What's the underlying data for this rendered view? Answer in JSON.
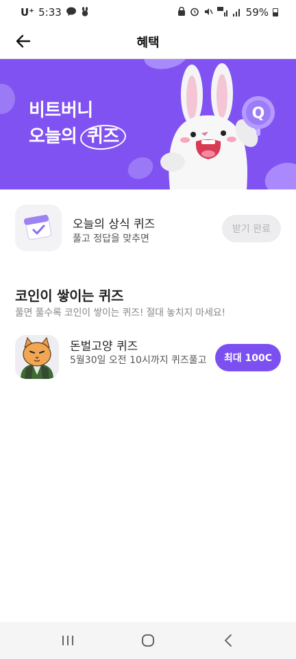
{
  "status_bar": {
    "carrier": "U⁺",
    "time": "5:33",
    "battery": "59%"
  },
  "header": {
    "title": "혜택",
    "back_icon": "arrow-left-icon"
  },
  "banner": {
    "line1": "비트버니",
    "line2_prefix": "오늘의",
    "line2_highlight": "퀴즈",
    "badge": "Q",
    "bg_color": "#8152f2"
  },
  "daily_quiz": {
    "title": "오늘의 상식 퀴즈",
    "subtitle": "풀고 정답을 맞추면",
    "button_label": "받기 완료"
  },
  "section": {
    "title": "코인이 쌓이는 퀴즈",
    "subtitle": "풀면 풀수록 코인이 쌓이는 퀴즈! 절대 놓치지 마세요!"
  },
  "coin_quiz": {
    "title": "돈벌고양 퀴즈",
    "subtitle": "5월30일 오전 10시까지 퀴즈풀고",
    "button_label": "최대 100C",
    "accent_color": "#7c4ff0"
  },
  "nav_bar": {
    "recents_icon": "recents-icon",
    "home_icon": "home-icon",
    "back_icon": "back-chevron-icon"
  }
}
